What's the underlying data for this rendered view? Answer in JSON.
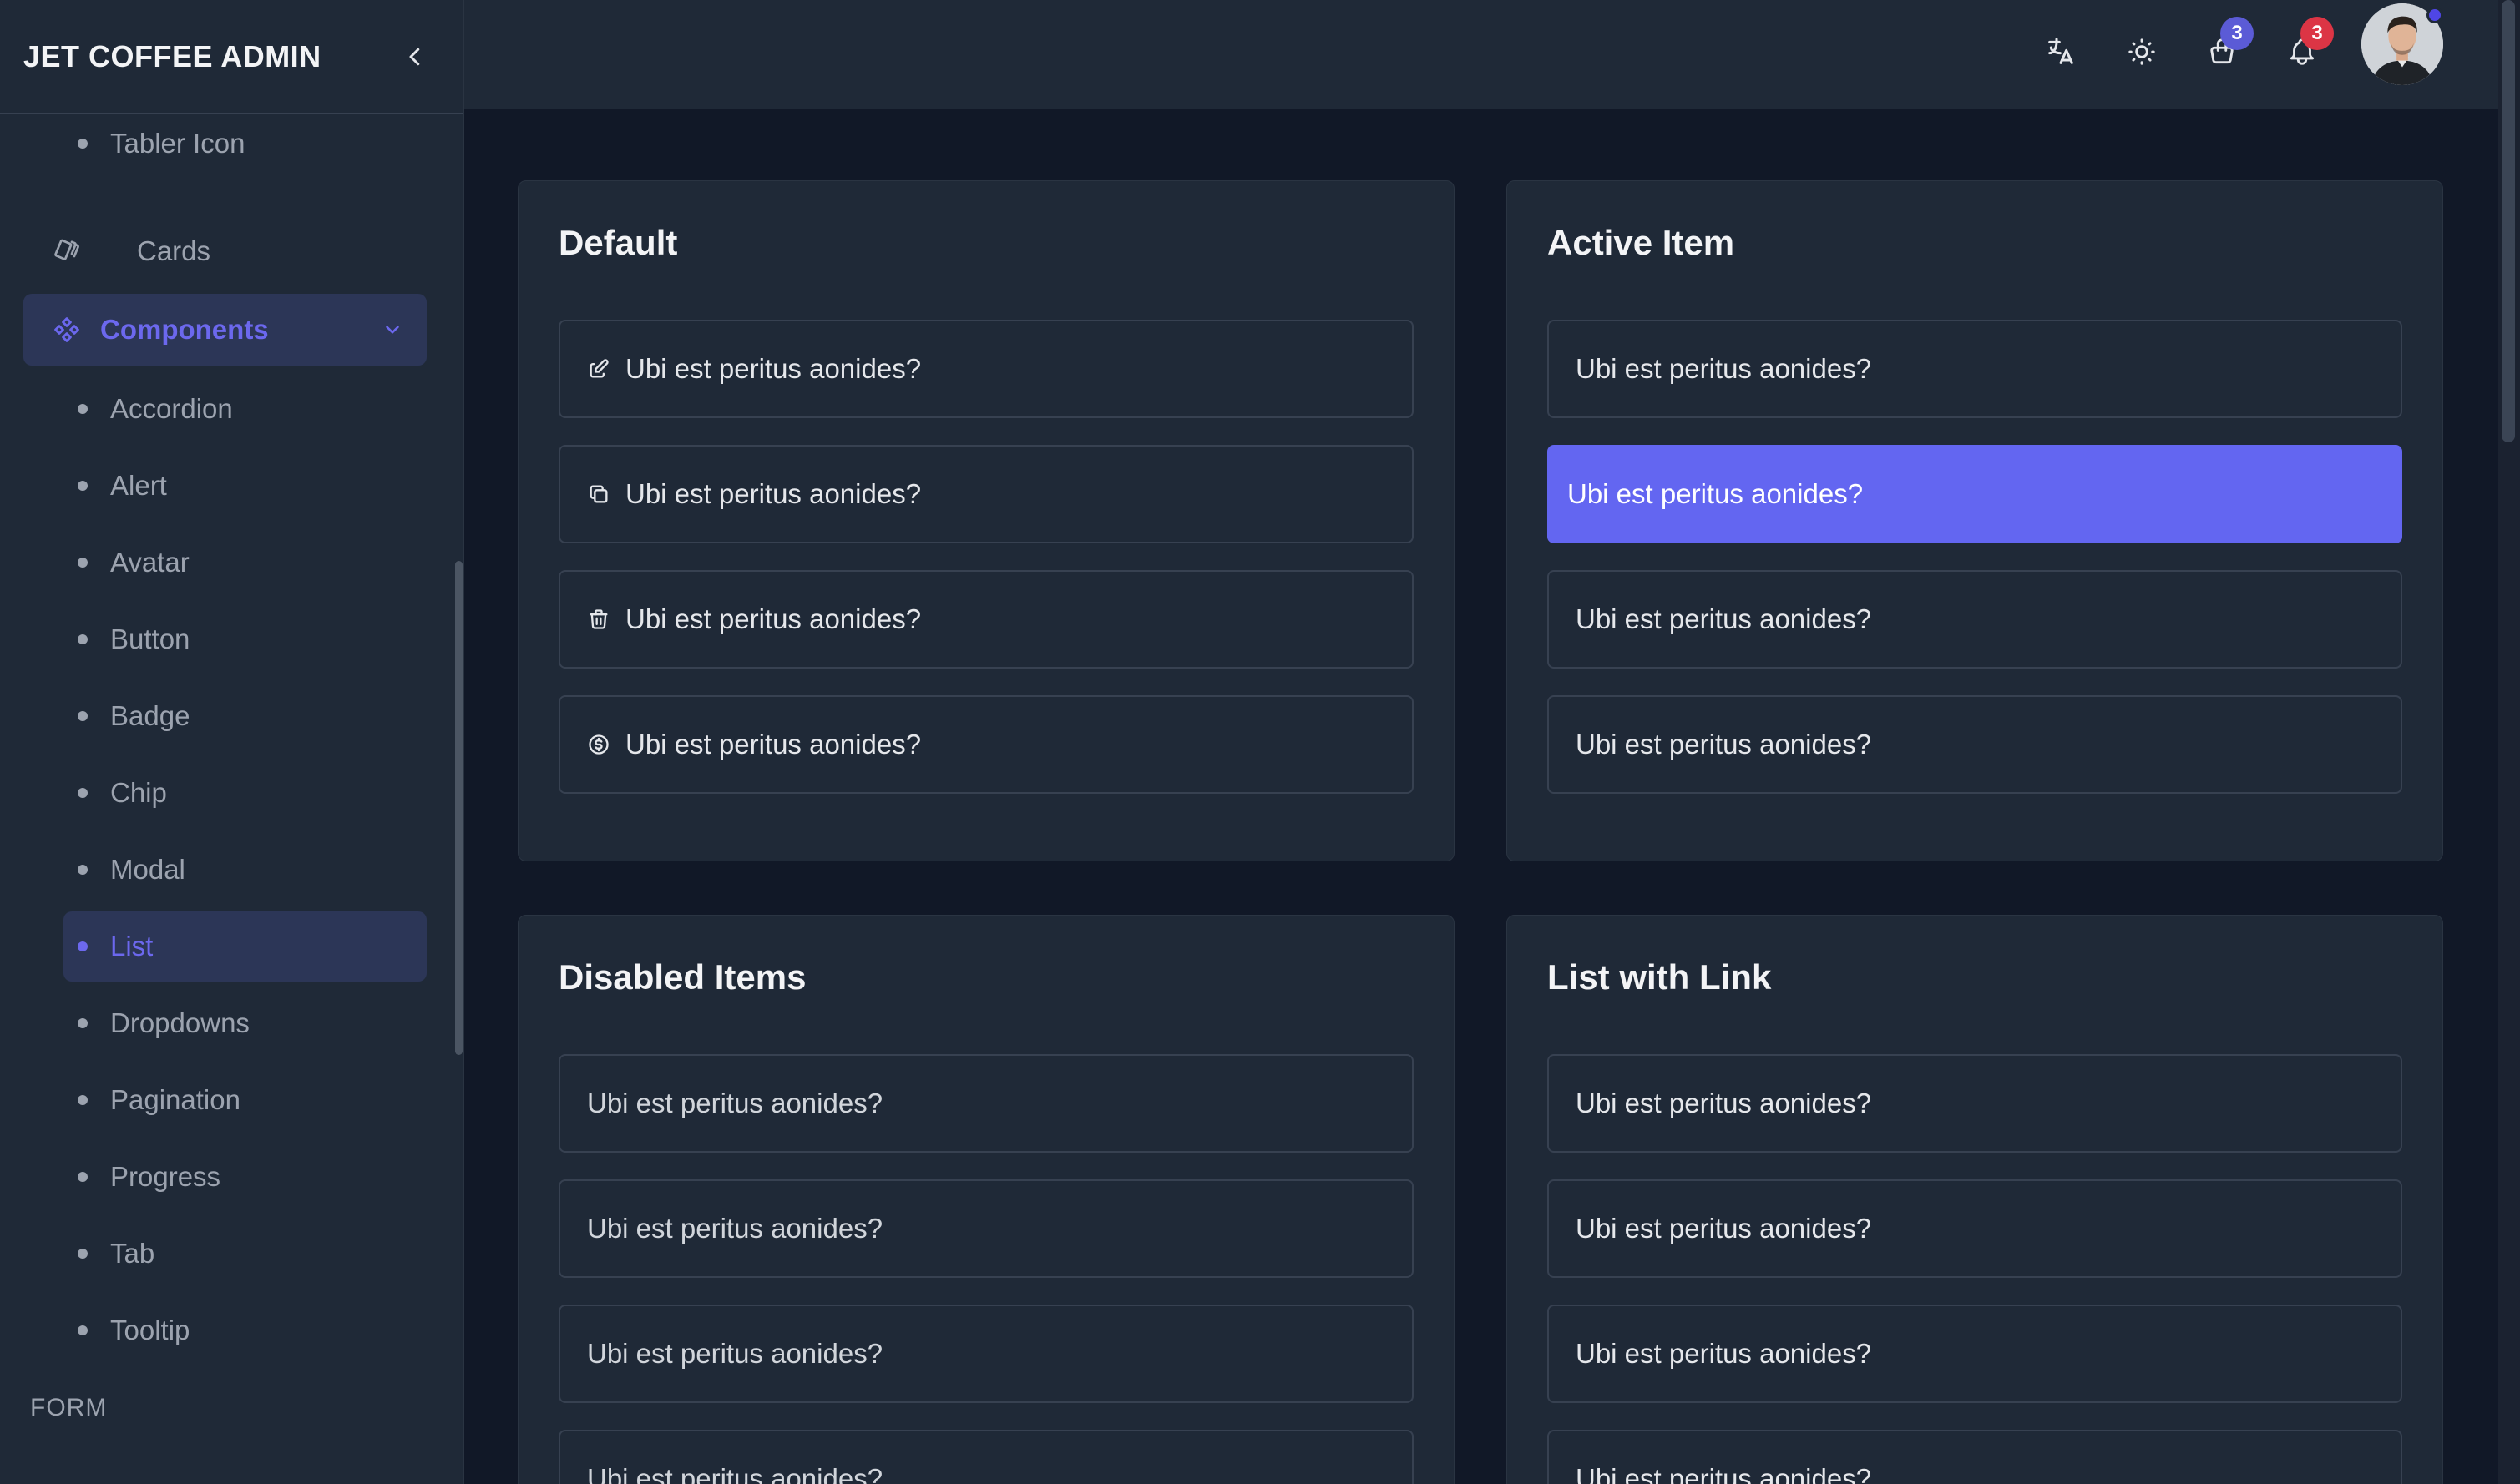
{
  "brand": {
    "title": "JET COFFEE ADMIN"
  },
  "sidebar": {
    "items_before": [
      {
        "label": "Tabler Icon",
        "kind": "sub"
      },
      {
        "label": "Cards",
        "kind": "top",
        "icon": "cards-icon"
      }
    ],
    "open_group": {
      "label": "Components",
      "icon": "components-icon"
    },
    "components": [
      {
        "label": "Accordion"
      },
      {
        "label": "Alert"
      },
      {
        "label": "Avatar"
      },
      {
        "label": "Button"
      },
      {
        "label": "Badge"
      },
      {
        "label": "Chip"
      },
      {
        "label": "Modal"
      },
      {
        "label": "List",
        "active": true
      },
      {
        "label": "Dropdowns"
      },
      {
        "label": "Pagination"
      },
      {
        "label": "Progress"
      },
      {
        "label": "Tab"
      },
      {
        "label": "Tooltip"
      }
    ],
    "section_form": "FORM"
  },
  "header": {
    "icons": [
      "translate-icon",
      "sun-icon",
      "shopping-bag-icon",
      "bell-icon"
    ],
    "cart_badge": "3",
    "notification_badge": "3",
    "cart_badge_color": "#5b5bd6",
    "notification_badge_color": "#dc3545"
  },
  "cards": {
    "default": {
      "title": "Default",
      "items": [
        {
          "label": "Ubi est peritus aonides?",
          "icon": "edit-icon"
        },
        {
          "label": "Ubi est peritus aonides?",
          "icon": "copy-icon"
        },
        {
          "label": "Ubi est peritus aonides?",
          "icon": "trash-icon"
        },
        {
          "label": "Ubi est peritus aonides?",
          "icon": "coin-icon"
        }
      ]
    },
    "active": {
      "title": "Active Item",
      "items": [
        {
          "label": "Ubi est peritus aonides?"
        },
        {
          "label": "Ubi est peritus aonides?",
          "active": true
        },
        {
          "label": "Ubi est peritus aonides?"
        },
        {
          "label": "Ubi est peritus aonides?"
        }
      ]
    },
    "disabled": {
      "title": "Disabled Items",
      "items": [
        {
          "label": "Ubi est peritus aonides?"
        },
        {
          "label": "Ubi est peritus aonides?"
        },
        {
          "label": "Ubi est peritus aonides?"
        },
        {
          "label": "Ubi est peritus aonides?"
        }
      ]
    },
    "links": {
      "title": "List with Link",
      "items": [
        {
          "label": "Ubi est peritus aonides?"
        },
        {
          "label": "Ubi est peritus aonides?"
        },
        {
          "label": "Ubi est peritus aonides?"
        },
        {
          "label": "Ubi est peritus aonides?"
        }
      ]
    }
  },
  "colors": {
    "accent": "#6366f1",
    "sidebar_bg": "#1f2937",
    "page_bg": "#111827"
  }
}
